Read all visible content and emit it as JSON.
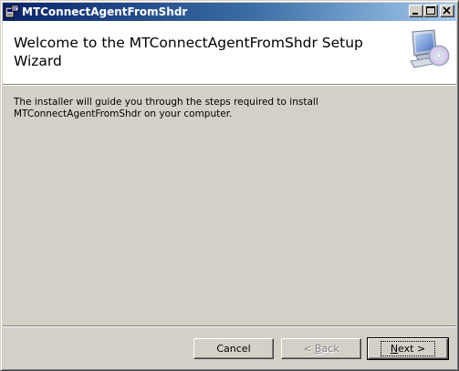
{
  "window": {
    "title": "MTConnectAgentFromShdr"
  },
  "header": {
    "title": "Welcome to the MTConnectAgentFromShdr Setup Wizard"
  },
  "body": {
    "description": "The installer will guide you through the steps required to install MTConnectAgentFromShdr on your computer."
  },
  "buttons": {
    "cancel": "Cancel",
    "back_prefix": "< ",
    "back_hotkey": "B",
    "back_rest": "ack",
    "next_hotkey": "N",
    "next_rest": "ext >"
  },
  "icons": {
    "app": "installer-app-icon",
    "minimize": "minimize-icon",
    "maximize": "maximize-icon",
    "close": "close-icon",
    "banner": "computer-cd-icon"
  },
  "colors": {
    "titlebar_start": "#0a246a",
    "titlebar_end": "#a6caf0",
    "face": "#d4d0c8",
    "header_bg": "#ffffff"
  }
}
